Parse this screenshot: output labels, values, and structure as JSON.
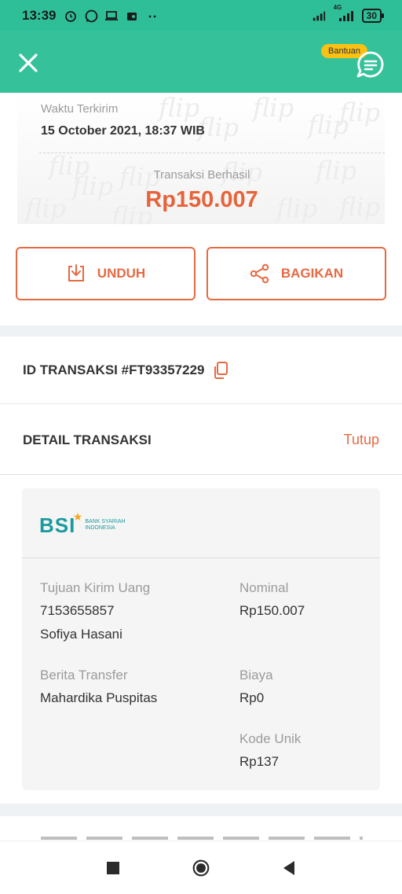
{
  "status_bar": {
    "time": "13:39",
    "network": "4G",
    "battery": "30"
  },
  "app_bar": {
    "help_badge": "Bantuan"
  },
  "receipt": {
    "watermark_text": "flip",
    "sent_time_label": "Waktu Terkirim",
    "sent_time_value": "15 October 2021, 18:37 WIB",
    "status": "Transaksi Berhasil",
    "amount": "Rp150.007"
  },
  "actions": {
    "download_label": "UNDUH",
    "share_label": "BAGIKAN"
  },
  "transaction": {
    "id_text": "ID TRANSAKSI #FT93357229"
  },
  "detail": {
    "title": "DETAIL TRANSAKSI",
    "close_label": "Tutup",
    "bank": {
      "logo_text": "BSI",
      "logo_subtext_line1": "BANK SYARIAH",
      "logo_subtext_line2": "INDONESIA"
    },
    "recipient_label": "Tujuan Kirim Uang",
    "account_number": "7153655857",
    "recipient_name": "Sofiya Hasani",
    "message_label": "Berita Transfer",
    "message_value": "Mahardika Puspitas",
    "nominal_label": "Nominal",
    "nominal_value": "Rp150.007",
    "fee_label": "Biaya",
    "fee_value": "Rp0",
    "unique_code_label": "Kode Unik",
    "unique_code_value": "Rp137"
  },
  "colors": {
    "brand_green": "#35c29b",
    "accent_orange": "#e56a43",
    "badge_yellow": "#f9c114",
    "bsi_teal": "#1a9a9f"
  }
}
